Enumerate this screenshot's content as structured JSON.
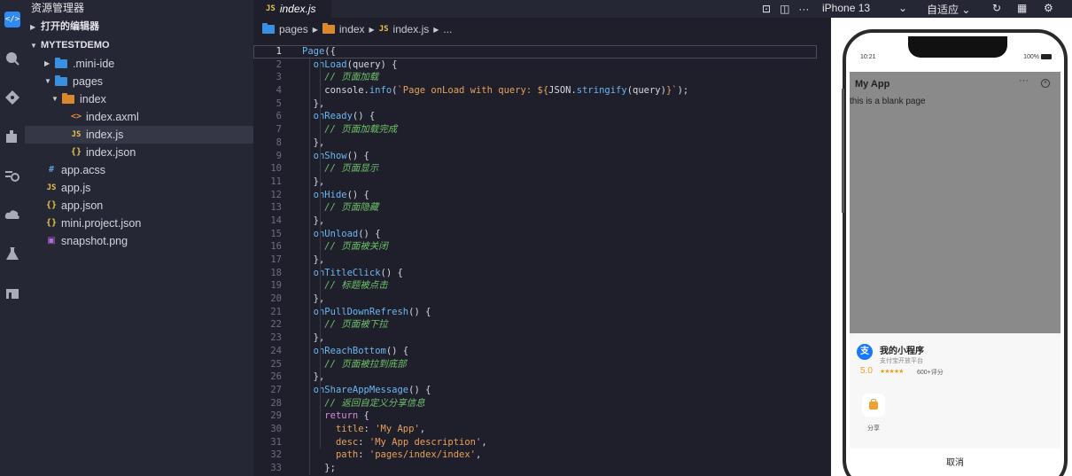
{
  "explorer": {
    "title": "资源管理器",
    "open_editors": "打开的编辑器",
    "project": "MYTESTDEMO",
    "tree": [
      {
        "label": ".mini-ide",
        "type": "folder",
        "depth": 1,
        "expanded": false
      },
      {
        "label": "pages",
        "type": "folder",
        "depth": 1,
        "expanded": true
      },
      {
        "label": "index",
        "type": "folder-orange",
        "depth": 2,
        "expanded": true
      },
      {
        "label": "index.axml",
        "type": "axml",
        "depth": 3
      },
      {
        "label": "index.js",
        "type": "js",
        "depth": 3,
        "selected": true
      },
      {
        "label": "index.json",
        "type": "json",
        "depth": 3
      },
      {
        "label": "app.acss",
        "type": "acss",
        "depth": 1
      },
      {
        "label": "app.js",
        "type": "js",
        "depth": 1
      },
      {
        "label": "app.json",
        "type": "json",
        "depth": 1
      },
      {
        "label": "mini.project.json",
        "type": "json",
        "depth": 1
      },
      {
        "label": "snapshot.png",
        "type": "png",
        "depth": 1
      }
    ]
  },
  "editor": {
    "tab_label": "index.js",
    "breadcrumb": [
      "pages",
      "index",
      "index.js",
      "..."
    ],
    "current_line": 1
  },
  "simulator": {
    "device": "iPhone 13",
    "zoom": "自适应",
    "status_time": "10:21",
    "battery": "100%",
    "app_title": "My App",
    "page_text": "this is a blank page",
    "sheet": {
      "name": "我的小程序",
      "sub": "支付宝开放平台",
      "score": "5.0",
      "stars": "★★★★★",
      "reviews": "600+评分",
      "share_label": "分享",
      "cancel_label": "取消"
    }
  },
  "colors": {
    "accent": "#2f8af5",
    "sidebar_bg": "#262735",
    "editor_bg": "#1e1f2b"
  }
}
